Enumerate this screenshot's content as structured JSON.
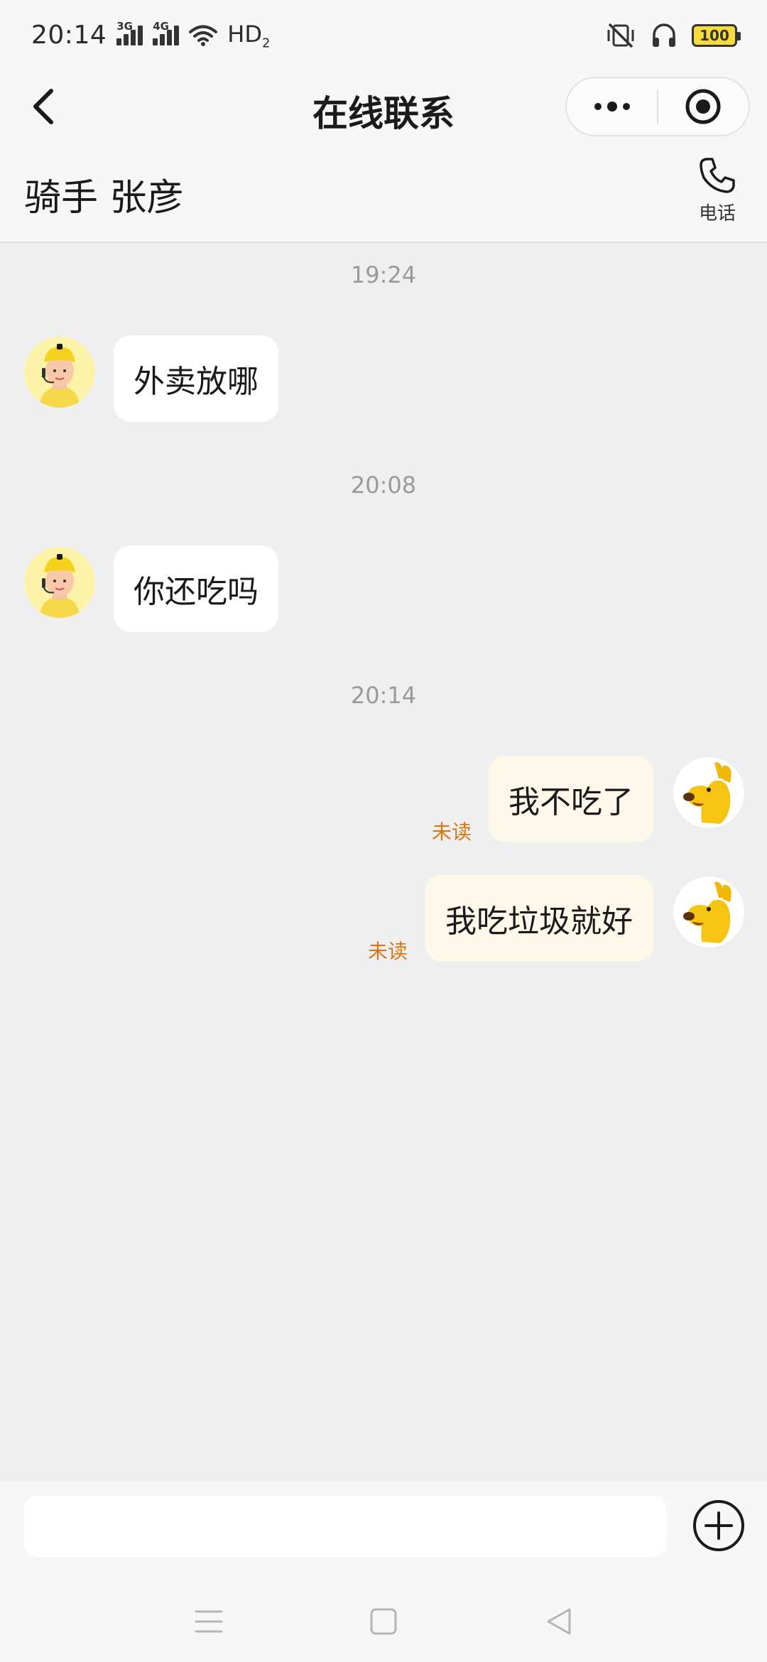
{
  "status_bar": {
    "time": "20:14",
    "network_1": "3G",
    "network_2": "4G",
    "hd": "HD",
    "hd_sub": "2",
    "battery": "100",
    "icons": [
      "signal-icon",
      "wifi-icon",
      "mute-vibrate-icon",
      "headphones-icon",
      "battery-icon"
    ]
  },
  "header": {
    "title": "在线联系",
    "back_icon": "chevron-left-icon",
    "more_icon": "more-dots-icon",
    "close_icon": "target-circle-icon"
  },
  "rider": {
    "name": "骑手 张彦",
    "phone_label": "电话",
    "phone_icon": "phone-icon"
  },
  "messages": [
    {
      "time": "19:24",
      "from": "rider",
      "text": "外卖放哪"
    },
    {
      "time": "20:08",
      "from": "rider",
      "text": "你还吃吗"
    },
    {
      "time": "20:14",
      "from": "me",
      "text": "我不吃了",
      "status": "未读"
    },
    {
      "from": "me",
      "text": "我吃垃圾就好",
      "status": "未读"
    }
  ],
  "composer": {
    "value": "",
    "placeholder": "",
    "plus_icon": "plus-circle-icon"
  },
  "nav": {
    "icons": [
      "menu-icon",
      "home-square-icon",
      "back-triangle-icon"
    ]
  },
  "colors": {
    "background": "#efefef",
    "incoming_bubble": "#ffffff",
    "outgoing_bubble": "#fdf8ea",
    "unread": "#d97614",
    "battery": "#f5dc3c"
  }
}
